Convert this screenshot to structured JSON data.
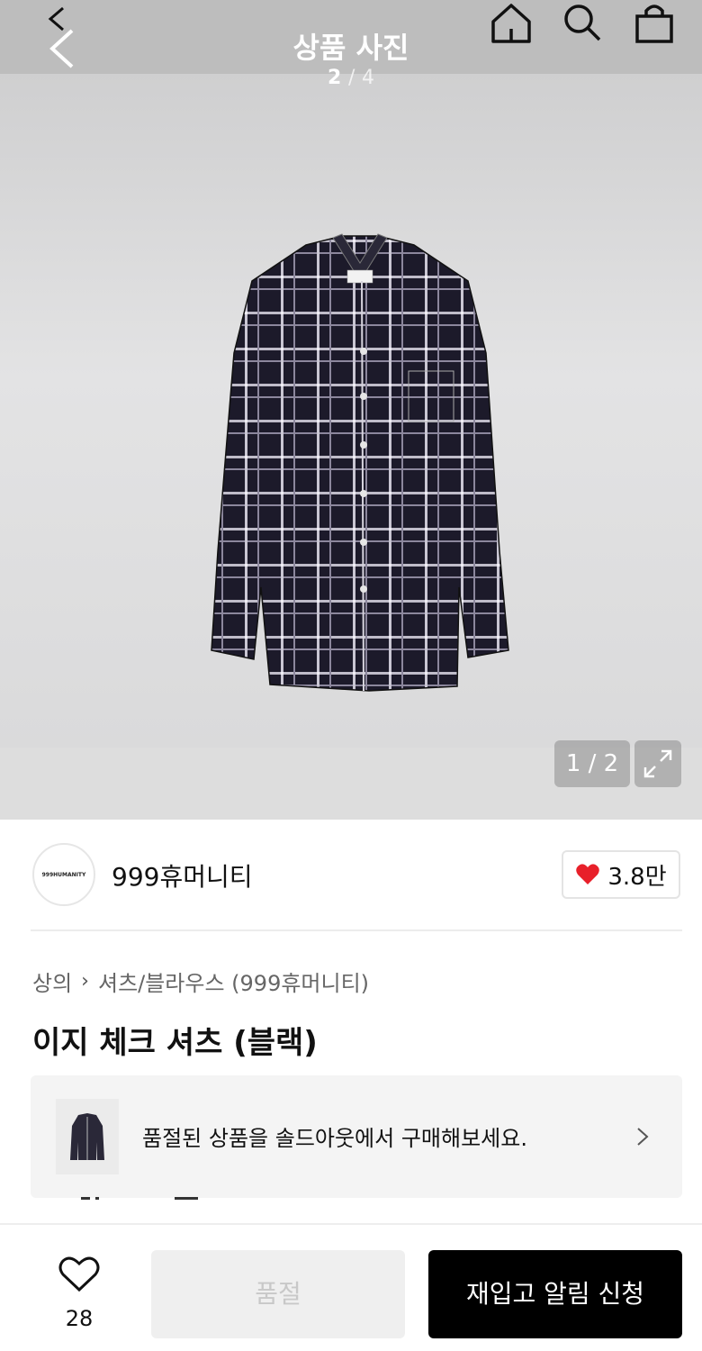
{
  "header": {
    "title": "상품 사진",
    "counter_current": "2",
    "counter_separator": "/",
    "counter_total": "4"
  },
  "image": {
    "counter": "1 / 2"
  },
  "brand": {
    "logo_text": "999HUMANITY",
    "name": "999휴머니티",
    "like_count": "3.8만"
  },
  "product": {
    "breadcrumb": [
      "상의",
      "셔츠/블라우스 (999휴머니티)"
    ],
    "title": "이지 체크 셔츠 (블랙)"
  },
  "banner": {
    "text": "품절된 상품을 솔드아웃에서 구매해보세요."
  },
  "bottom": {
    "wish_count": "28",
    "soldout_label": "품절",
    "restock_label": "재입고 알림 신청"
  },
  "colors": {
    "accent_heart": "#e8202a",
    "primary_button": "#000000",
    "disabled_button": "#efefef"
  }
}
